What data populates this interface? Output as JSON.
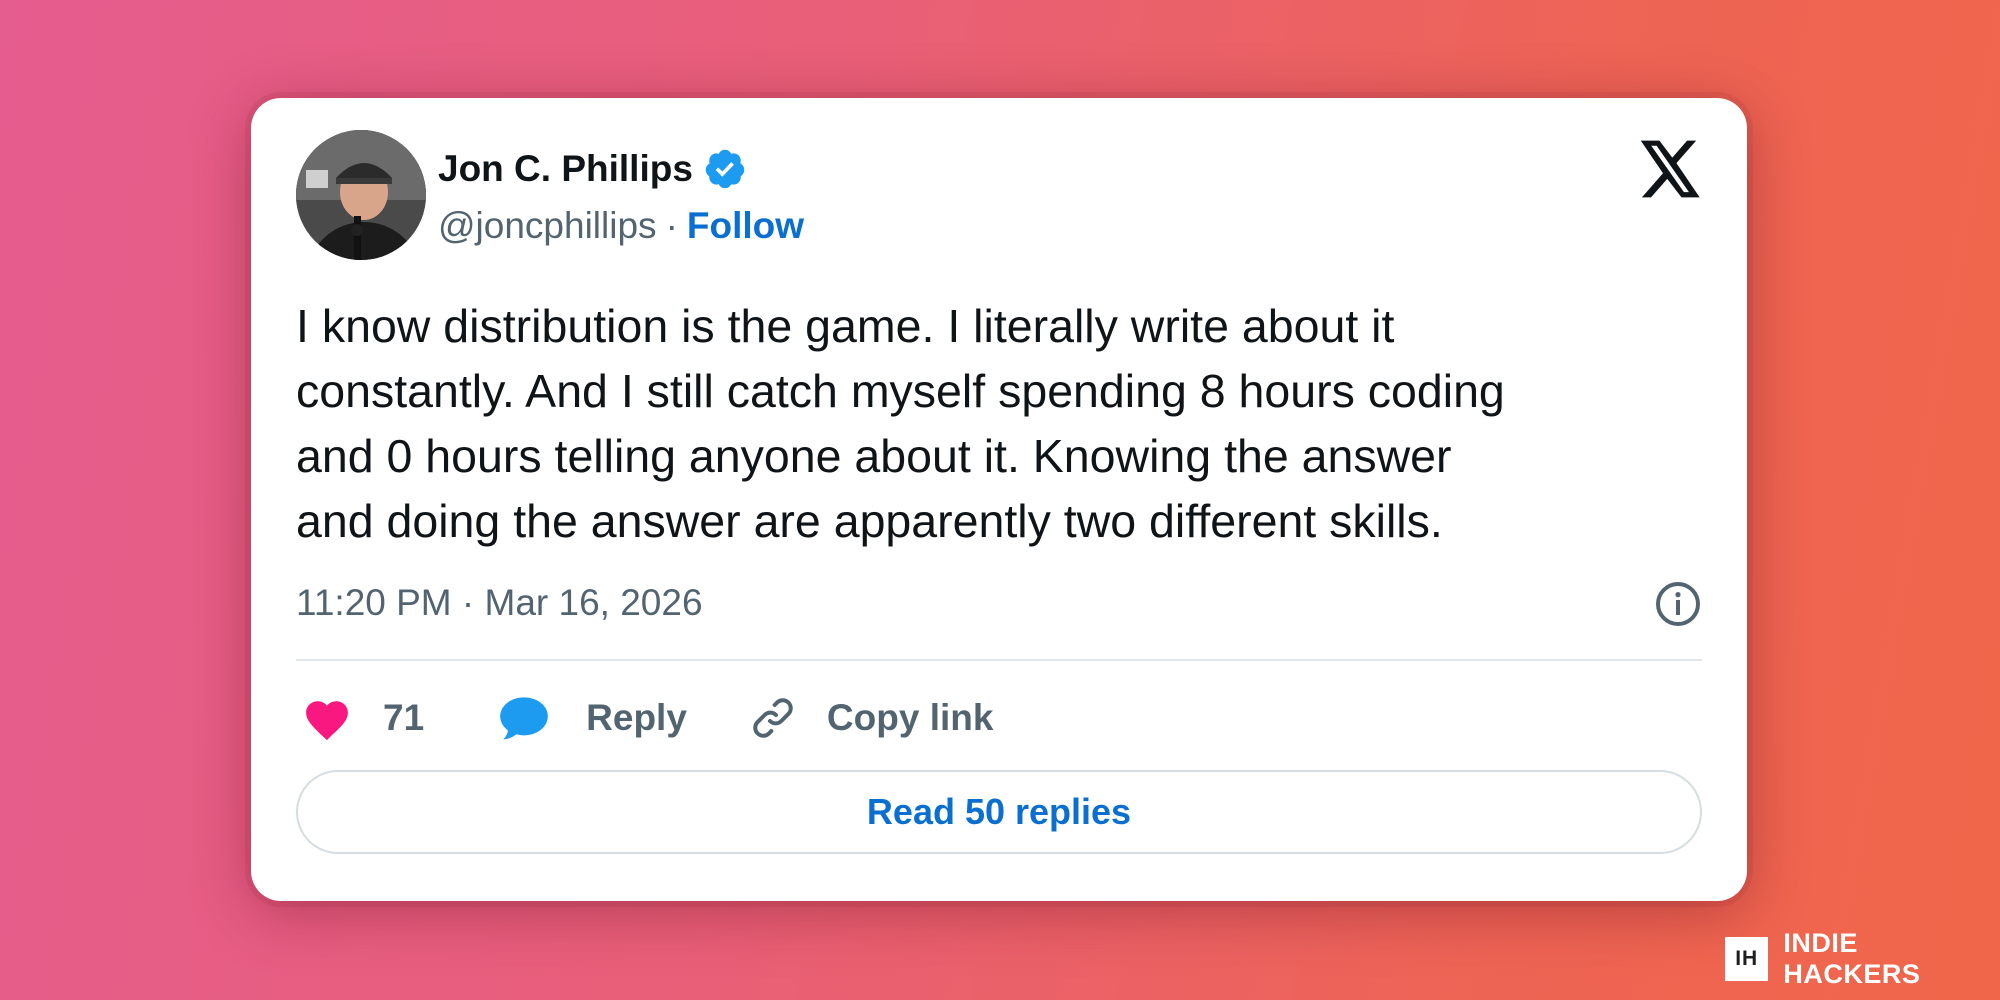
{
  "author": {
    "name": "Jon C. Phillips",
    "handle": "@joncphillips",
    "separator": "·",
    "follow_label": "Follow",
    "verified": true
  },
  "tweet": {
    "text": "I know distribution is the game. I literally write about it\nconstantly. And I still catch myself spending 8 hours coding\nand 0 hours telling anyone about it. Knowing the answer\nand doing the answer are apparently two different skills.",
    "timestamp": "11:20 PM · Mar 16, 2026"
  },
  "actions": {
    "like_count": "71",
    "reply_label": "Reply",
    "copy_link_label": "Copy link",
    "read_replies_label": "Read 50 replies"
  },
  "icons": {
    "platform": "x-logo-icon",
    "verified": "verified-badge-icon",
    "info": "info-icon",
    "like": "heart-icon",
    "reply": "speech-bubble-icon",
    "copy": "link-icon"
  },
  "colors": {
    "accent_blue": "#0b6fd1",
    "verified_blue": "#1d9bf0",
    "like_pink": "#f91880",
    "text_primary": "#0f1419",
    "text_secondary": "#536471"
  },
  "branding": {
    "mark": "IH",
    "name": "INDIE HACKERS"
  }
}
